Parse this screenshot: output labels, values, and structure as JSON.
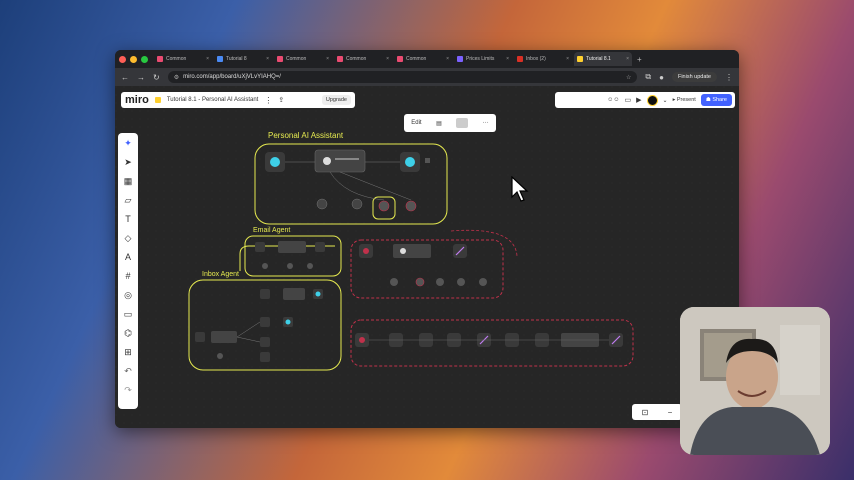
{
  "browser": {
    "tabs": [
      {
        "label": "Common",
        "active": false
      },
      {
        "label": "Tutorial 8",
        "active": false
      },
      {
        "label": "Common",
        "active": false
      },
      {
        "label": "Common",
        "active": false
      },
      {
        "label": "Common",
        "active": false
      },
      {
        "label": "Prices Limits",
        "active": false
      },
      {
        "label": "Inbox (2)",
        "active": false
      },
      {
        "label": "Tutorial 8.1",
        "active": true
      }
    ],
    "url": "miro.com/app/board/uXjVLvYIAHQ=/",
    "finish_update_label": "Finish update"
  },
  "miro": {
    "logo": "miro",
    "board_title": "Tutorial 8.1 - Personal AI Assistant",
    "upgrade_label": "Upgrade",
    "present_label": "Present",
    "share_label": "Share",
    "context_toolbar": {
      "edit_label": "Edit"
    },
    "frames": {
      "personal": "Personal AI Assistant",
      "email": "Email Agent",
      "inbox": "Inbox Agent"
    }
  },
  "colors": {
    "frame_yellow": "#e6ea50",
    "frame_red": "#c0314b",
    "node_teal": "#3ed0e8",
    "accent_blue": "#4262ff"
  }
}
